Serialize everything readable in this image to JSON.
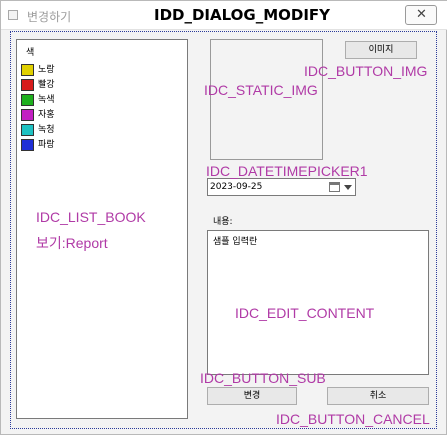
{
  "window": {
    "title": "변경하기",
    "dialog_id": "IDD_DIALOG_MODIFY",
    "close_glyph": "✕"
  },
  "list": {
    "header": "색",
    "items": [
      {
        "label": "노랑",
        "color": "#e0d000"
      },
      {
        "label": "빨강",
        "color": "#d61c1c"
      },
      {
        "label": "녹색",
        "color": "#1fb01f"
      },
      {
        "label": "자홍",
        "color": "#c21fc2"
      },
      {
        "label": "녹청",
        "color": "#1fc2c2"
      },
      {
        "label": "파랑",
        "color": "#1f2fd6"
      }
    ]
  },
  "image_button": {
    "label": "이미지"
  },
  "datetime": {
    "value": "2023-09-25"
  },
  "content": {
    "label": "내용:",
    "text": "샘플 입력란"
  },
  "buttons": {
    "sub": "변경",
    "cancel": "취소"
  },
  "annotations": {
    "static_img": "IDC_STATIC_IMG",
    "button_img": "IDC_BUTTON_IMG",
    "datetimepicker": "IDC_DATETIMEPICKER1",
    "list_book": "IDC_LIST_BOOK",
    "list_view": "보기:Report",
    "edit_content": "IDC_EDIT_CONTENT",
    "button_sub": "IDC_BUTTON_SUB",
    "button_cancel": "IDC_BUTTON_CANCEL"
  },
  "annotation_color": "#b03aa6"
}
